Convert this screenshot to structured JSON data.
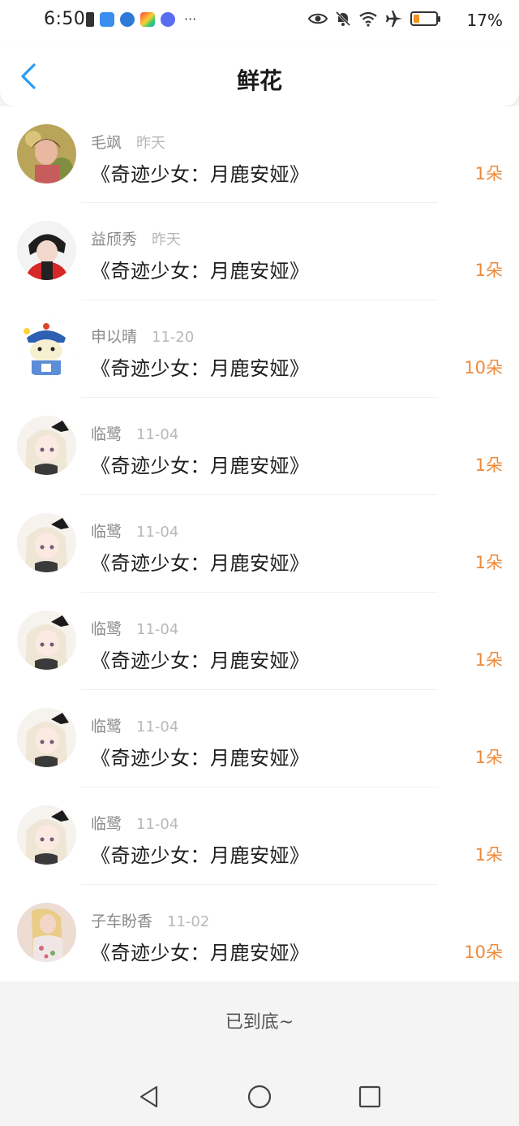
{
  "status_bar": {
    "time": "6:50",
    "battery_text": "17%",
    "more": "···",
    "icons": [
      "sim-icon",
      "cloud-icon",
      "globe-icon",
      "gallery-icon",
      "music-icon",
      "eye-icon",
      "bell-off-icon",
      "wifi-icon",
      "airplane-icon",
      "battery-icon"
    ],
    "battery_color": "#f29220"
  },
  "header": {
    "title": "鲜花"
  },
  "items": [
    {
      "name": "毛飒",
      "date": "昨天",
      "book": "《奇迹少女：月鹿安娅》",
      "count": "1朵"
    },
    {
      "name": "益颀秀",
      "date": "昨天",
      "book": "《奇迹少女：月鹿安娅》",
      "count": "1朵"
    },
    {
      "name": "申以晴",
      "date": "11-20",
      "book": "《奇迹少女：月鹿安娅》",
      "count": "10朵"
    },
    {
      "name": "临鹭",
      "date": "11-04",
      "book": "《奇迹少女：月鹿安娅》",
      "count": "1朵"
    },
    {
      "name": "临鹭",
      "date": "11-04",
      "book": "《奇迹少女：月鹿安娅》",
      "count": "1朵"
    },
    {
      "name": "临鹭",
      "date": "11-04",
      "book": "《奇迹少女：月鹿安娅》",
      "count": "1朵"
    },
    {
      "name": "临鹭",
      "date": "11-04",
      "book": "《奇迹少女：月鹿安娅》",
      "count": "1朵"
    },
    {
      "name": "临鹭",
      "date": "11-04",
      "book": "《奇迹少女：月鹿安娅》",
      "count": "1朵"
    },
    {
      "name": "子车盼香",
      "date": "11-02",
      "book": "《奇迹少女：月鹿安娅》",
      "count": "10朵"
    }
  ],
  "footer": {
    "end_text": "已到底~"
  },
  "colors": {
    "accent": "#2b9cf2",
    "count": "#ee8a3a"
  }
}
